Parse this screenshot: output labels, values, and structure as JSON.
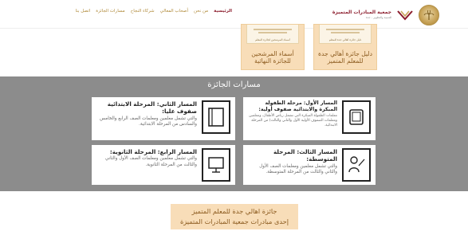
{
  "header": {
    "brand": {
      "name": "جمعية المبادرات المتميزة",
      "sub": "للتنمية والتطوير - جدة"
    },
    "nav": [
      {
        "label": "الرئيسية",
        "active": true
      },
      {
        "label": "من نحن",
        "active": false
      },
      {
        "label": "أصحاب المعالي",
        "active": false
      },
      {
        "label": "شركاء النجاح",
        "active": false
      },
      {
        "label": "مسارات الجائزة",
        "active": false
      },
      {
        "label": "اتصل بنا",
        "active": false
      }
    ]
  },
  "publications": [
    {
      "title": "دليل جائزة أهالي جدة للمعلم المتميز",
      "cover_caption": "دليل جائزة أهالي جدة للمعلم"
    },
    {
      "title": "أسماء المرشحين للجائزة النهائية",
      "cover_caption": "أسماء المرشحين لجائزة المعلم"
    }
  ],
  "tracks": {
    "title": "مسارات الجائزة",
    "items": [
      {
        "title": "المسار الأول: مرحلة الطفولة المبكرة والابتدائية صفوف أولية:",
        "desc": "معلمات الطفولة المبكرة التي تشمل رياض الأطفال، ومعلمين ومعلمات الصفوف الأولية الأول والثاني والثالث) من المرحلة الابتدائية.",
        "icon": "tablet-icon"
      },
      {
        "title": "المسار الثاني: المرحلة الابتدائية صفوف عليا:",
        "desc": "والتي تشمل معلمين ومعلمات الصف الرابع والخامس والسادس من المرحلة الابتدائية.",
        "icon": "book-icon"
      },
      {
        "title": "المسار الثالث: المرحلة المتوسطة:",
        "desc": "والتي تشمل معلمين ومعلمات الصف الأول والثاني والثالث من المرحلة المتوسطة.",
        "icon": "teacher-icon"
      },
      {
        "title": "المسار الرابع: المرحلة الثانوية:",
        "desc": "والتي تشمل معلمين ومعلمات الصف الأول والثاني والثالث من المرحلة الثانوية.",
        "icon": "monitor-icon"
      }
    ]
  },
  "banner": {
    "line1": "جائزة اهالي جدة للمعلم المتميز",
    "line2": "إحدى مبادرات جمعية المبادرات المتميزة"
  },
  "colors": {
    "accent_gold": "#b08a3a",
    "accent_maroon": "#8b1c2c",
    "peach": "#f8ddb8",
    "section_gray": "#8c8c8c"
  }
}
